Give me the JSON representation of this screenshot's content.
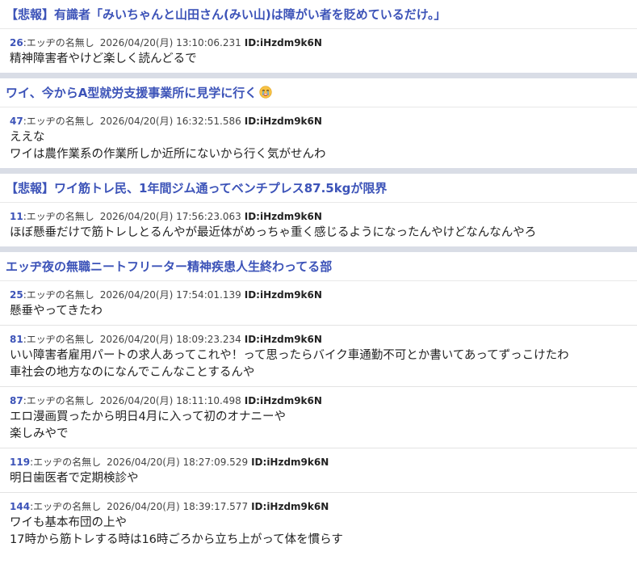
{
  "threads": [
    {
      "title": "【悲報】有識者「みいちゃんと山田さん(みい山)は障がい者を貶めているだけ。」",
      "posts": [
        {
          "num": "26",
          "author": "エッヂの名無し",
          "date": "2026/04/20(月) 13:10:06.231",
          "id": "ID:iHzdm9k6N",
          "lines": [
            "精神障害者やけど楽しく読んどるで"
          ]
        }
      ]
    },
    {
      "title": "ワイ、今からA型就労支援事業所に見学に行く",
      "emoji": "crying-face-icon",
      "posts": [
        {
          "num": "47",
          "author": "エッヂの名無し",
          "date": "2026/04/20(月) 16:32:51.586",
          "id": "ID:iHzdm9k6N",
          "lines": [
            "ええな",
            "ワイは農作業系の作業所しか近所にないから行く気がせんわ"
          ]
        }
      ]
    },
    {
      "title": "【悲報】ワイ筋トレ民、1年間ジム通ってベンチプレス87.5kgが限界",
      "posts": [
        {
          "num": "11",
          "author": "エッヂの名無し",
          "date": "2026/04/20(月) 17:56:23.063",
          "id": "ID:iHzdm9k6N",
          "lines": [
            "ほぼ懸垂だけで筋トレしとるんやが最近体がめっちゃ重く感じるようになったんやけどなんなんやろ"
          ]
        }
      ]
    },
    {
      "title": "エッヂ夜の無職ニートフリーター精神疾患人生終わってる部",
      "posts": [
        {
          "num": "25",
          "author": "エッヂの名無し",
          "date": "2026/04/20(月) 17:54:01.139",
          "id": "ID:iHzdm9k6N",
          "lines": [
            "懸垂やってきたわ"
          ]
        },
        {
          "num": "81",
          "author": "エッヂの名無し",
          "date": "2026/04/20(月) 18:09:23.234",
          "id": "ID:iHzdm9k6N",
          "lines": [
            "いい障害者雇用パートの求人あってこれや！って思ったらバイク車通勤不可とか書いてあってずっこけたわ",
            "車社会の地方なのになんでこんなことするんや"
          ]
        },
        {
          "num": "87",
          "author": "エッヂの名無し",
          "date": "2026/04/20(月) 18:11:10.498",
          "id": "ID:iHzdm9k6N",
          "lines": [
            "エロ漫画買ったから明日4月に入って初のオナニーや",
            "楽しみやで"
          ]
        },
        {
          "num": "119",
          "author": "エッヂの名無し",
          "date": "2026/04/20(月) 18:27:09.529",
          "id": "ID:iHzdm9k6N",
          "lines": [
            "明日歯医者で定期検診や"
          ]
        },
        {
          "num": "144",
          "author": "エッヂの名無し",
          "date": "2026/04/20(月) 18:39:17.577",
          "id": "ID:iHzdm9k6N",
          "lines": [
            "ワイも基本布団の上や",
            "17時から筋トレする時は16時ごろから立ち上がって体を慣らす"
          ]
        }
      ]
    }
  ]
}
